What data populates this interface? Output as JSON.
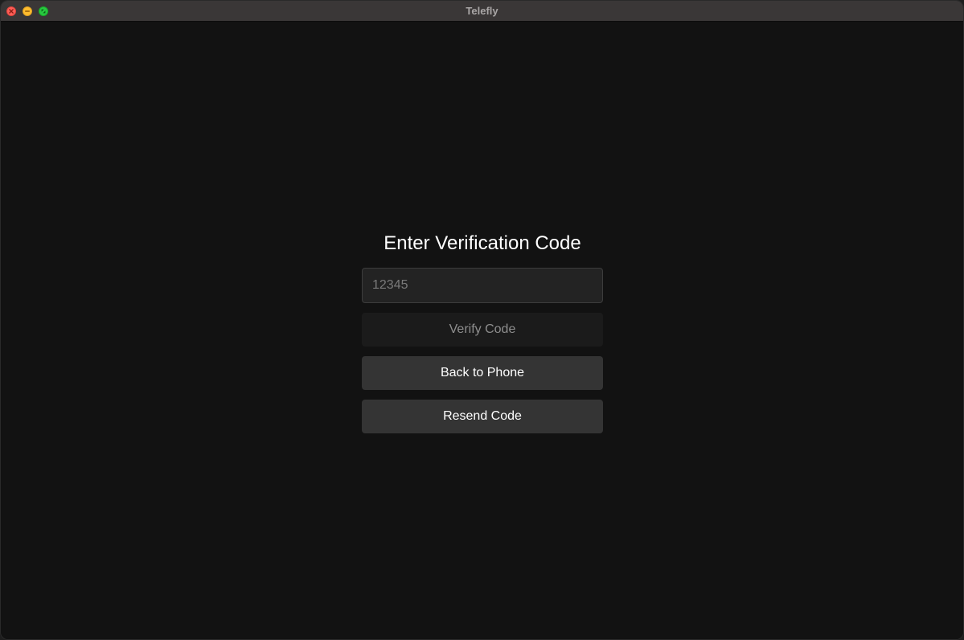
{
  "window": {
    "title": "Telefly",
    "controls": {
      "close_icon": "close-icon",
      "minimize_icon": "minimize-icon",
      "maximize_icon": "fullscreen-icon"
    }
  },
  "verification": {
    "heading": "Enter Verification Code",
    "code_input": {
      "placeholder": "12345",
      "value": ""
    },
    "verify_button": {
      "label": "Verify Code",
      "enabled": false
    },
    "back_button": {
      "label": "Back to Phone"
    },
    "resend_button": {
      "label": "Resend Code"
    }
  },
  "colors": {
    "background": "#121212",
    "titlebar": "#3a3737",
    "input_background": "#232323",
    "secondary_button": "#343434",
    "disabled_button": "#1b1b1b",
    "text_primary": "#ffffff",
    "text_muted": "#8e8e8e"
  }
}
